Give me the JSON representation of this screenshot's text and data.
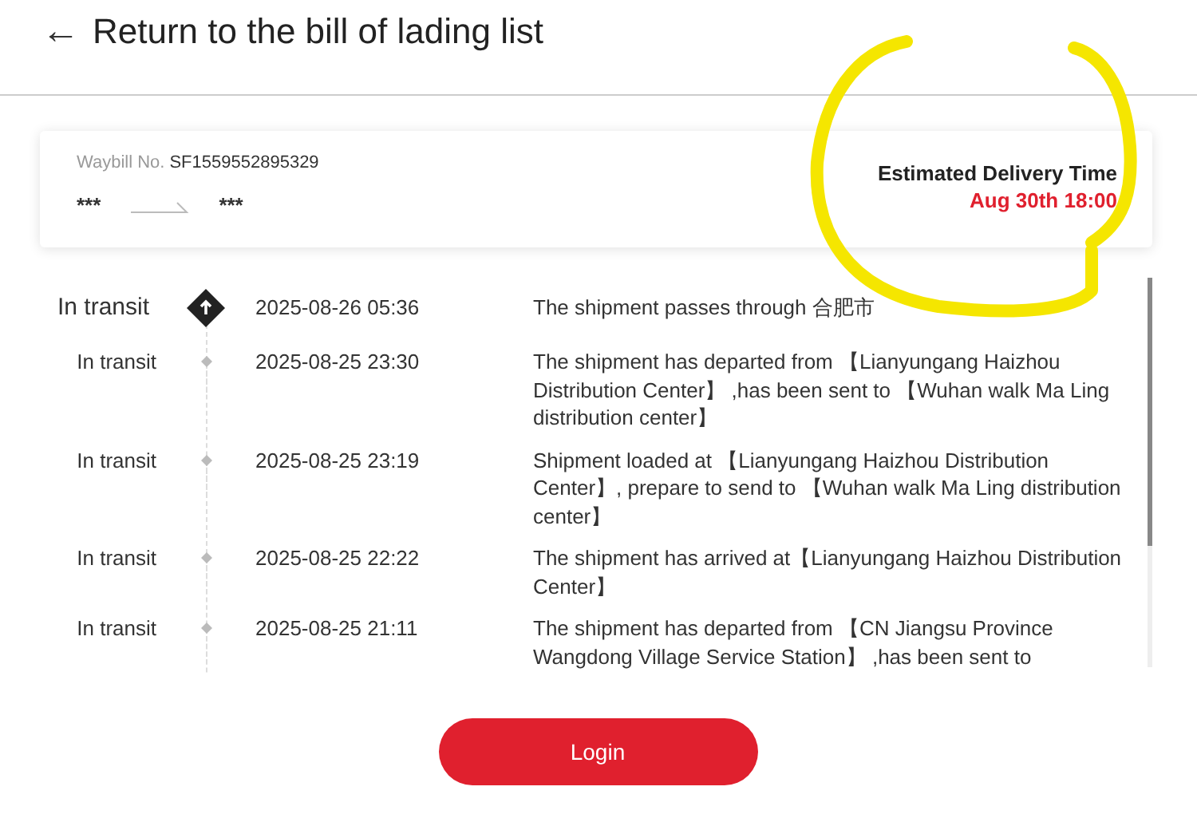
{
  "header": {
    "back_icon": "←",
    "title": "Return to the bill of lading list"
  },
  "waybill": {
    "label": "Waybill No.",
    "number": "SF1559552895329",
    "origin": "***",
    "destination": "***",
    "eta_label": "Estimated Delivery Time",
    "eta_value": "Aug 30th 18:00"
  },
  "tracking": [
    {
      "kind": "current",
      "status": "In transit",
      "time": "2025-08-26 05:36",
      "description": "The shipment passes through 合肥市"
    },
    {
      "kind": "past",
      "status": "In transit",
      "time": "2025-08-25 23:30",
      "description": "The shipment has departed from 【Lianyungang Haizhou Distribution Center】 ,has been sent to 【Wuhan walk Ma Ling distribution center】"
    },
    {
      "kind": "past",
      "status": "In transit",
      "time": "2025-08-25 23:19",
      "description": "Shipment loaded at 【Lianyungang Haizhou Distribution Center】, prepare to send to 【Wuhan walk Ma Ling distribution center】"
    },
    {
      "kind": "past",
      "status": "In transit",
      "time": "2025-08-25 22:22",
      "description": "The shipment has arrived at【Lianyungang Haizhou Distribution Center】"
    },
    {
      "kind": "past",
      "status": "In transit",
      "time": "2025-08-25 21:11",
      "description": "The shipment has departed from 【CN Jiangsu Province Wangdong Village Service Station】 ,has been sent to"
    }
  ],
  "login_button": "Login"
}
